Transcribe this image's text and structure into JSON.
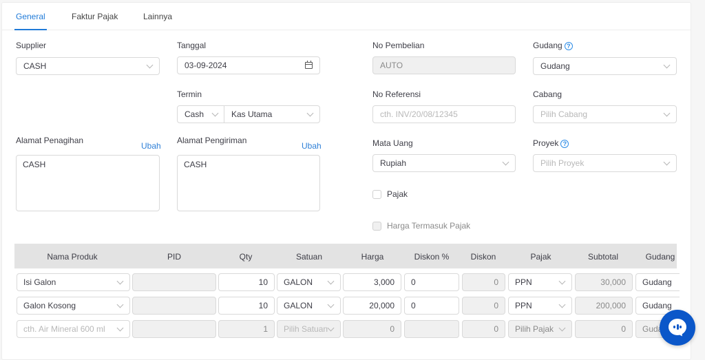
{
  "tabs": [
    {
      "label": "General",
      "active": true
    },
    {
      "label": "Faktur Pajak",
      "active": false
    },
    {
      "label": "Lainnya",
      "active": false
    }
  ],
  "form": {
    "supplier": {
      "label": "Supplier",
      "value": "CASH"
    },
    "tanggal": {
      "label": "Tanggal",
      "value": "03-09-2024",
      "icon": "calendar-icon"
    },
    "termin": {
      "label": "Termin",
      "term_value": "Cash",
      "account_value": "Kas Utama"
    },
    "no_pembelian": {
      "label": "No Pembelian",
      "value": "AUTO"
    },
    "no_referensi": {
      "label": "No Referensi",
      "placeholder": "cth. INV/20/08/12345"
    },
    "gudang": {
      "label": "Gudang",
      "value": "Gudang",
      "help_icon": "?"
    },
    "cabang": {
      "label": "Cabang",
      "placeholder": "Pilih Cabang"
    },
    "alamat_penagihan": {
      "label": "Alamat Penagihan",
      "link": "Ubah",
      "value": "CASH"
    },
    "alamat_pengiriman": {
      "label": "Alamat Pengiriman",
      "link": "Ubah",
      "value": "CASH"
    },
    "mata_uang": {
      "label": "Mata Uang",
      "value": "Rupiah"
    },
    "proyek": {
      "label": "Proyek",
      "placeholder": "Pilih Proyek",
      "help_icon": "?"
    },
    "pajak": {
      "label": "Pajak",
      "checked": false
    },
    "harga_termasuk_pajak": {
      "label": "Harga Termasuk Pajak",
      "checked": false,
      "disabled": true
    }
  },
  "table": {
    "headers": [
      "Nama Produk",
      "PID",
      "Qty",
      "Satuan",
      "Harga",
      "Diskon %",
      "Diskon",
      "Pajak",
      "Subtotal",
      "Gudang"
    ],
    "rows": [
      {
        "produk": "Isi Galon",
        "pid": "",
        "qty": "10",
        "satuan": "GALON",
        "harga": "3,000",
        "diskon_pct": "0",
        "diskon": "0",
        "pajak": "PPN",
        "subtotal": "30,000",
        "gudang": "Gudang"
      },
      {
        "produk": "Galon Kosong",
        "pid": "",
        "qty": "10",
        "satuan": "GALON",
        "harga": "20,000",
        "diskon_pct": "0",
        "diskon": "0",
        "pajak": "PPN",
        "subtotal": "200,000",
        "gudang": "Gudang"
      }
    ],
    "new_row": {
      "produk_placeholder": "cth. Air Mineral 600 ml",
      "pid": "",
      "qty": "1",
      "satuan_placeholder": "Pilih Satuan",
      "harga": "0",
      "diskon_pct": "",
      "diskon": "0",
      "pajak_placeholder": "Pilih Pajak",
      "subtotal": "0",
      "gudang_placeholder": "Gudang"
    }
  },
  "colors": {
    "accent": "#1f7ad8",
    "chat_button": "#0b57c9",
    "table_header": "#e3e3e3"
  }
}
